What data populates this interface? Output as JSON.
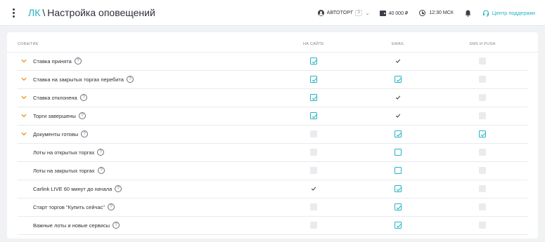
{
  "header": {
    "breadcrumb_root": "ЛК",
    "breadcrumb_sep": "\\",
    "page_title": "Настройка оповещений",
    "account_name": "АВТОТОРГ",
    "account_badge": "3",
    "balance": "40 000 ₽",
    "time": "12:30 МСК",
    "support_label": "Центр поддержки",
    "icons": [
      "kebab-menu-icon",
      "user-icon",
      "chevron-down-icon",
      "wallet-icon",
      "clock-icon",
      "bell-icon",
      "headset-icon"
    ]
  },
  "table": {
    "columns": [
      "СОБЫТИЕ",
      "НА САЙТЕ",
      "EMAIL",
      "SMS И PUSH"
    ],
    "rows": [
      {
        "label": "Ставка принята",
        "expandable": true,
        "site": "checked",
        "email": "disabled-checked",
        "sms": "disabled"
      },
      {
        "label": "Ставка на закрытых торгах перебита",
        "expandable": true,
        "site": "checked",
        "email": "checked",
        "sms": "disabled"
      },
      {
        "label": "Ставка отклонена",
        "expandable": true,
        "site": "checked",
        "email": "disabled-checked",
        "sms": "disabled"
      },
      {
        "label": "Торги завершены",
        "expandable": true,
        "site": "checked",
        "email": "disabled-checked",
        "sms": "disabled"
      },
      {
        "label": "Документы готовы",
        "expandable": true,
        "site": "disabled",
        "email": "checked",
        "sms": "checked"
      },
      {
        "label": "Лоты на открытых торгах",
        "expandable": false,
        "site": "disabled",
        "email": "unchecked",
        "sms": "disabled"
      },
      {
        "label": "Лоты на закрытых торгах",
        "expandable": false,
        "site": "disabled",
        "email": "unchecked",
        "sms": "disabled"
      },
      {
        "label": "Carlink LIVE 60 минут до начала",
        "expandable": false,
        "site": "disabled-checked",
        "email": "checked",
        "sms": "disabled"
      },
      {
        "label": "Старт торгов \"Купить сейчас\"",
        "expandable": false,
        "site": "disabled",
        "email": "checked",
        "sms": "disabled"
      },
      {
        "label": "Важные лоты и новые сервисы",
        "expandable": false,
        "site": "disabled",
        "email": "checked",
        "sms": "disabled"
      }
    ]
  },
  "colors": {
    "accent": "#23b3c4",
    "chevron": "#f0932b",
    "disabled_box": "#e9ebee",
    "text": "#2b2f36"
  }
}
